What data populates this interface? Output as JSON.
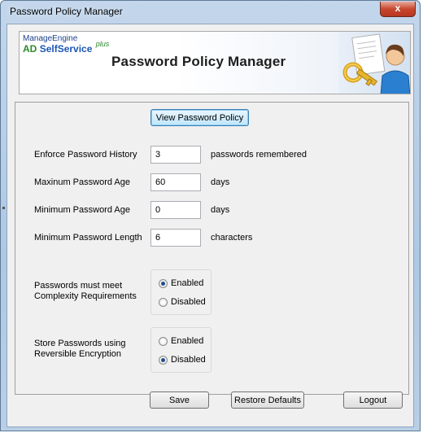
{
  "window": {
    "title": "Password Policy Manager",
    "close_glyph": "x"
  },
  "banner": {
    "brand_top": "ManageEngine",
    "brand_ad": "AD",
    "brand_selfservice": "SelfService",
    "brand_plus": "plus",
    "title": "Password Policy Manager",
    "graphic_icon": "key-and-user-icon"
  },
  "actions": {
    "view_policy": "View Password Policy",
    "save": "Save",
    "restore_defaults": "Restore Defaults",
    "logout": "Logout"
  },
  "settings": [
    {
      "label": "Enforce Password History",
      "value": "3",
      "unit": "passwords remembered"
    },
    {
      "label": "Maxinum Password Age",
      "value": "60",
      "unit": "days"
    },
    {
      "label": "Minimum Password Age",
      "value": "0",
      "unit": "days"
    },
    {
      "label": "Minimum Password Length",
      "value": "6",
      "unit": "characters"
    }
  ],
  "options": [
    {
      "label_line1": "Passwords must meet",
      "label_line2": "Complexity Requirements",
      "enabled_label": "Enabled",
      "disabled_label": "Disabled",
      "selected": "Enabled"
    },
    {
      "label_line1": "Store Passwords using",
      "label_line2": "Reversible Encryption",
      "enabled_label": "Enabled",
      "disabled_label": "Disabled",
      "selected": "Disabled"
    }
  ],
  "colors": {
    "title_bar": "#b9cfe6",
    "close_button": "#c8482f",
    "radio_selected": "#1f4e8c"
  }
}
